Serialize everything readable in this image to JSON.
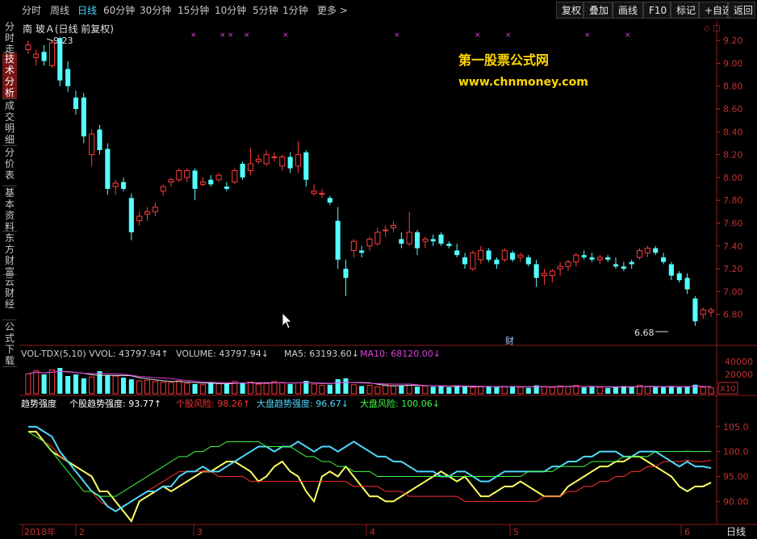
{
  "topbar": {
    "tabs": [
      "分时",
      "周线",
      "日线",
      "60分钟",
      "30分钟",
      "15分钟",
      "10分钟",
      "5分钟",
      "1分钟",
      "更多 >"
    ],
    "active_tab": "日线",
    "right_buttons": [
      "复权",
      "叠加",
      "画线",
      "F10",
      "标记",
      "+自选",
      "返回"
    ]
  },
  "sidebar": {
    "tabs": [
      "分时走势",
      "技术分析",
      "成交明细",
      "分价表",
      "基本资料",
      "东方财富",
      "云财经",
      "公式下载"
    ],
    "active": "技术分析"
  },
  "main_chart": {
    "title": "南 玻Ａ(日线 前复权)",
    "high_label": "9.23",
    "low_label": "6.68",
    "watermark_cn": "第一股票公式网",
    "watermark_url": "www.chnmoney.com",
    "finance_marker": "财",
    "price_axis": [
      "9.20",
      "9.00",
      "8.80",
      "8.60",
      "8.40",
      "8.20",
      "8.00",
      "7.80",
      "7.60",
      "7.40",
      "7.20",
      "7.00",
      "6.80"
    ]
  },
  "volume_panel": {
    "indicators": [
      {
        "text": "VOL-TDX(5,10) VVOL: 43797.94↑",
        "color": "#d0d0d0"
      },
      {
        "text": "VOLUME: 43797.94↓",
        "color": "#d0d0d0"
      },
      {
        "text": "MA5: 63193.60↓",
        "color": "#d0d0d0"
      },
      {
        "text": "MA10: 68120.00↓",
        "color": "#e040e0"
      }
    ],
    "axis": [
      "40000",
      "20000"
    ],
    "unit": "X10"
  },
  "strength_panel": {
    "indicators": [
      {
        "text": "趋势强度",
        "color": "#ffffff"
      },
      {
        "text": "个股趋势强度: 93.77↑",
        "color": "#ffffff"
      },
      {
        "text": "个股风险: 98.26↑",
        "color": "#ff3030"
      },
      {
        "text": "大盘趋势强度: 96.67↓",
        "color": "#4fd8ff"
      },
      {
        "text": "大盘风险: 100.06↓",
        "color": "#40ff40"
      }
    ],
    "axis": [
      "105.0",
      "100.0",
      "95.00",
      "90.00"
    ]
  },
  "bottom_axis": {
    "labels": [
      "2018年",
      "2",
      "3",
      "4",
      "5",
      "6"
    ],
    "period": "日线"
  },
  "chart_data": {
    "type": "candlestick",
    "ylim": [
      6.6,
      9.3
    ],
    "candles": [
      [
        9.12,
        9.2,
        9.08,
        9.16
      ],
      [
        9.05,
        9.12,
        8.98,
        9.08
      ],
      [
        9.1,
        9.16,
        8.98,
        9.02
      ],
      [
        8.98,
        9.2,
        8.96,
        9.18
      ],
      [
        9.22,
        9.23,
        8.8,
        8.85
      ],
      [
        8.95,
        9.02,
        8.75,
        8.8
      ],
      [
        8.7,
        8.76,
        8.55,
        8.6
      ],
      [
        8.7,
        8.74,
        8.3,
        8.36
      ],
      [
        8.2,
        8.42,
        8.1,
        8.38
      ],
      [
        8.42,
        8.46,
        8.2,
        8.24
      ],
      [
        8.25,
        8.3,
        7.85,
        7.9
      ],
      [
        7.92,
        7.98,
        7.85,
        7.95
      ],
      [
        7.96,
        8.0,
        7.88,
        7.9
      ],
      [
        7.82,
        7.86,
        7.45,
        7.52
      ],
      [
        7.62,
        7.7,
        7.58,
        7.66
      ],
      [
        7.68,
        7.74,
        7.62,
        7.7
      ],
      [
        7.7,
        7.78,
        7.66,
        7.74
      ],
      [
        7.88,
        7.94,
        7.84,
        7.92
      ],
      [
        7.96,
        8.0,
        7.92,
        7.98
      ],
      [
        7.98,
        8.08,
        7.96,
        8.06
      ],
      [
        8.0,
        8.08,
        7.96,
        8.06
      ],
      [
        8.06,
        8.08,
        7.8,
        7.9
      ],
      [
        7.94,
        8.0,
        7.92,
        7.96
      ],
      [
        7.98,
        8.02,
        7.92,
        7.94
      ],
      [
        7.98,
        8.04,
        7.96,
        8.02
      ],
      [
        7.92,
        7.96,
        7.88,
        7.9
      ],
      [
        7.96,
        8.08,
        7.94,
        8.06
      ],
      [
        8.12,
        8.14,
        7.98,
        8.0
      ],
      [
        8.06,
        8.26,
        8.02,
        8.12
      ],
      [
        8.14,
        8.2,
        8.12,
        8.16
      ],
      [
        8.12,
        8.24,
        8.1,
        8.2
      ],
      [
        8.18,
        8.22,
        8.14,
        8.18
      ],
      [
        8.1,
        8.2,
        8.06,
        8.18
      ],
      [
        8.18,
        8.22,
        8.04,
        8.08
      ],
      [
        8.1,
        8.32,
        8.04,
        8.2
      ],
      [
        8.22,
        8.24,
        7.92,
        7.98
      ],
      [
        7.86,
        7.94,
        7.84,
        7.88
      ],
      [
        7.86,
        7.9,
        7.82,
        7.86
      ],
      [
        7.82,
        7.84,
        7.76,
        7.78
      ],
      [
        7.62,
        7.74,
        7.2,
        7.28
      ],
      [
        7.2,
        7.28,
        6.96,
        7.12
      ],
      [
        7.36,
        7.46,
        7.3,
        7.44
      ],
      [
        7.36,
        7.4,
        7.3,
        7.34
      ],
      [
        7.4,
        7.48,
        7.36,
        7.46
      ],
      [
        7.42,
        7.56,
        7.4,
        7.52
      ],
      [
        7.54,
        7.58,
        7.48,
        7.54
      ],
      [
        7.56,
        7.62,
        7.52,
        7.58
      ],
      [
        7.46,
        7.52,
        7.38,
        7.42
      ],
      [
        7.42,
        7.7,
        7.4,
        7.52
      ],
      [
        7.52,
        7.54,
        7.32,
        7.38
      ],
      [
        7.44,
        7.48,
        7.38,
        7.46
      ],
      [
        7.46,
        7.5,
        7.4,
        7.44
      ],
      [
        7.5,
        7.52,
        7.4,
        7.42
      ],
      [
        7.42,
        7.44,
        7.38,
        7.4
      ],
      [
        7.36,
        7.42,
        7.3,
        7.32
      ],
      [
        7.3,
        7.34,
        7.2,
        7.24
      ],
      [
        7.2,
        7.36,
        7.18,
        7.34
      ],
      [
        7.28,
        7.4,
        7.24,
        7.36
      ],
      [
        7.36,
        7.38,
        7.26,
        7.28
      ],
      [
        7.28,
        7.3,
        7.2,
        7.24
      ],
      [
        7.28,
        7.38,
        7.26,
        7.36
      ],
      [
        7.34,
        7.36,
        7.26,
        7.28
      ],
      [
        7.3,
        7.34,
        7.26,
        7.32
      ],
      [
        7.3,
        7.32,
        7.22,
        7.24
      ],
      [
        7.24,
        7.28,
        7.04,
        7.12
      ],
      [
        7.14,
        7.2,
        7.06,
        7.16
      ],
      [
        7.14,
        7.2,
        7.08,
        7.18
      ],
      [
        7.2,
        7.26,
        7.14,
        7.22
      ],
      [
        7.22,
        7.28,
        7.18,
        7.26
      ],
      [
        7.26,
        7.34,
        7.22,
        7.32
      ],
      [
        7.32,
        7.36,
        7.28,
        7.3
      ],
      [
        7.3,
        7.34,
        7.26,
        7.28
      ],
      [
        7.28,
        7.32,
        7.24,
        7.3
      ],
      [
        7.3,
        7.32,
        7.26,
        7.28
      ],
      [
        7.24,
        7.3,
        7.2,
        7.22
      ],
      [
        7.22,
        7.26,
        7.18,
        7.2
      ],
      [
        7.26,
        7.28,
        7.2,
        7.24
      ],
      [
        7.3,
        7.38,
        7.28,
        7.36
      ],
      [
        7.34,
        7.4,
        7.3,
        7.38
      ],
      [
        7.38,
        7.4,
        7.32,
        7.34
      ],
      [
        7.3,
        7.34,
        7.24,
        7.26
      ],
      [
        7.24,
        7.26,
        7.1,
        7.14
      ],
      [
        7.16,
        7.18,
        7.08,
        7.1
      ],
      [
        7.12,
        7.16,
        6.98,
        7.02
      ],
      [
        6.94,
        6.96,
        6.7,
        6.74
      ],
      [
        6.8,
        6.86,
        6.76,
        6.84
      ],
      [
        6.82,
        6.86,
        6.78,
        6.84
      ]
    ],
    "volume": [
      62,
      72,
      60,
      74,
      80,
      55,
      60,
      48,
      52,
      70,
      58,
      55,
      50,
      45,
      40,
      42,
      38,
      36,
      35,
      40,
      32,
      30,
      28,
      35,
      32,
      30,
      38,
      34,
      36,
      30,
      32,
      38,
      35,
      30,
      34,
      40,
      30,
      26,
      28,
      45,
      48,
      28,
      24,
      26,
      22,
      28,
      24,
      26,
      30,
      22,
      24,
      22,
      24,
      20,
      26,
      22,
      20,
      22,
      24,
      20,
      22,
      24,
      20,
      18,
      26,
      22,
      20,
      24,
      22,
      26,
      20,
      22,
      20,
      18,
      22,
      24,
      20,
      26,
      22,
      20,
      22,
      24,
      20,
      22,
      28,
      20,
      18
    ],
    "strength_series": [
      {
        "name": "个股趋势强度",
        "color": "#ffff60",
        "values": [
          104,
          104,
          102,
          100,
          99,
          98,
          97,
          96,
          95,
          92,
          92,
          90,
          88,
          86,
          90,
          91,
          92,
          93,
          92,
          93,
          94,
          95,
          96,
          96,
          97,
          98,
          98,
          97,
          96,
          94,
          95,
          97,
          98,
          96,
          95,
          92,
          90,
          95,
          96,
          95,
          97,
          95,
          93,
          91,
          91,
          90,
          90,
          91,
          92,
          93,
          94,
          95,
          96,
          95,
          94,
          95,
          93,
          91,
          91,
          92,
          93,
          93,
          94,
          93,
          92,
          91,
          91,
          91,
          93,
          94,
          95,
          96,
          97,
          97,
          98,
          98,
          99,
          99,
          98,
          97,
          96,
          95,
          93,
          92,
          93,
          93,
          93.77
        ]
      },
      {
        "name": "个股风险",
        "color": "#ff3030",
        "values": [
          104,
          103,
          102,
          101,
          99,
          98,
          96,
          94,
          92,
          90,
          89,
          88,
          89,
          90,
          91,
          92,
          93,
          94,
          95,
          96,
          96,
          96,
          96,
          96,
          95,
          95,
          95,
          95,
          94,
          94,
          94,
          94,
          94,
          94,
          94,
          94,
          94,
          94,
          94,
          94,
          94,
          93,
          93,
          93,
          93,
          92,
          92,
          92,
          91,
          91,
          91,
          91,
          91,
          91,
          91,
          90,
          90,
          90,
          90,
          90,
          90,
          90,
          90,
          90,
          90,
          91,
          91,
          91,
          92,
          92,
          93,
          93,
          94,
          94,
          95,
          95,
          96,
          96,
          97,
          97,
          98,
          98,
          98,
          98.26,
          98,
          98,
          98.26
        ]
      },
      {
        "name": "大盘趋势强度",
        "color": "#4fd8ff",
        "values": [
          105,
          105,
          104,
          103,
          100,
          98,
          96,
          94,
          92,
          91,
          89,
          88,
          89,
          90,
          91,
          92,
          92,
          93,
          93,
          95,
          96,
          96,
          97,
          96,
          96,
          97,
          98,
          99,
          100,
          101,
          101,
          100,
          101,
          101,
          102,
          101,
          100,
          101,
          101,
          100,
          101,
          102,
          101,
          100,
          99,
          99,
          98,
          98,
          97,
          96,
          96,
          96,
          95,
          95,
          96,
          96,
          95,
          94,
          94,
          95,
          96,
          96,
          96,
          96,
          96,
          96,
          97,
          97,
          98,
          98,
          99,
          99,
          100,
          100,
          100,
          99,
          99,
          100,
          100,
          100,
          99,
          98,
          97,
          98,
          97,
          97,
          96.67
        ]
      },
      {
        "name": "大盘风险",
        "color": "#40ff40",
        "values": [
          104,
          103,
          102,
          100,
          98,
          96,
          94,
          92,
          92,
          91,
          91,
          91,
          92,
          93,
          94,
          95,
          96,
          97,
          98,
          99,
          99,
          100,
          100,
          101,
          101,
          102,
          102,
          102,
          102,
          102,
          101,
          101,
          101,
          101,
          100,
          99,
          99,
          98,
          98,
          97,
          97,
          96,
          96,
          96,
          95,
          95,
          95,
          95,
          95,
          95,
          95,
          95,
          95,
          95,
          95,
          95,
          95,
          95,
          95,
          95,
          95,
          95,
          95,
          96,
          96,
          96,
          96,
          97,
          97,
          97,
          97,
          98,
          98,
          98,
          98,
          99,
          99,
          99,
          99,
          100,
          100,
          100,
          100,
          100.06,
          100,
          100,
          100.06
        ]
      }
    ],
    "strength_ylim": [
      86,
      110
    ]
  }
}
